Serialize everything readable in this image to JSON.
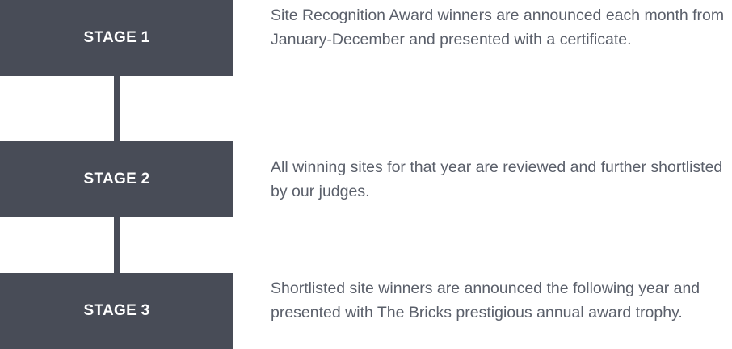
{
  "stages": [
    {
      "label": "STAGE 1",
      "description": "Site Recognition Award winners are announced each month from January-December and presented with a certificate."
    },
    {
      "label": "STAGE 2",
      "description": "All winning sites for that year are reviewed and further shortlisted by our judges."
    },
    {
      "label": "STAGE 3",
      "description": "Shortlisted site winners are announced the following year and presented with The Bricks prestigious annual award trophy."
    }
  ],
  "colors": {
    "box": "#484c57",
    "box_text": "#ffffff",
    "description_text": "#5a5f6a"
  }
}
